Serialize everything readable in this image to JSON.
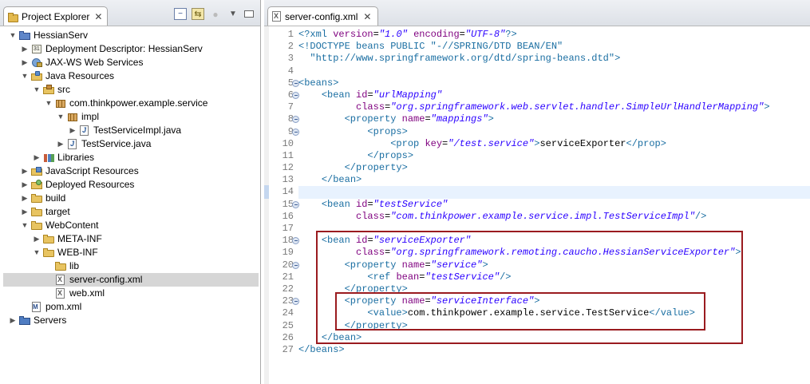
{
  "explorer": {
    "title": "Project Explorer",
    "close": "✕",
    "tools": [
      "collapse-all",
      "link-with-editor",
      "view-menu",
      "minimize"
    ],
    "tree": [
      {
        "label": "HessianServ",
        "icon": "project",
        "depth": 0,
        "twisty": "open"
      },
      {
        "label": "Deployment Descriptor: HessianServ",
        "icon": "descriptor",
        "depth": 1,
        "twisty": "closed"
      },
      {
        "label": "JAX-WS Web Services",
        "icon": "ws",
        "depth": 1,
        "twisty": "closed"
      },
      {
        "label": "Java Resources",
        "icon": "javares",
        "depth": 1,
        "twisty": "open"
      },
      {
        "label": "src",
        "icon": "srcfolder",
        "depth": 2,
        "twisty": "open"
      },
      {
        "label": "com.thinkpower.example.service",
        "icon": "pkg",
        "depth": 3,
        "twisty": "open"
      },
      {
        "label": "impl",
        "icon": "pkg",
        "depth": 4,
        "twisty": "open"
      },
      {
        "label": "TestServiceImpl.java",
        "icon": "javafile",
        "depth": 5,
        "twisty": "closed"
      },
      {
        "label": "TestService.java",
        "icon": "javafile",
        "depth": 4,
        "twisty": "closed"
      },
      {
        "label": "Libraries",
        "icon": "libs",
        "depth": 2,
        "twisty": "closed"
      },
      {
        "label": "JavaScript Resources",
        "icon": "js",
        "depth": 1,
        "twisty": "closed"
      },
      {
        "label": "Deployed Resources",
        "icon": "deployed",
        "depth": 1,
        "twisty": "closed"
      },
      {
        "label": "build",
        "icon": "folder",
        "depth": 1,
        "twisty": "closed"
      },
      {
        "label": "target",
        "icon": "folder",
        "depth": 1,
        "twisty": "closed"
      },
      {
        "label": "WebContent",
        "icon": "folder",
        "depth": 1,
        "twisty": "open"
      },
      {
        "label": "META-INF",
        "icon": "folder",
        "depth": 2,
        "twisty": "closed"
      },
      {
        "label": "WEB-INF",
        "icon": "folder",
        "depth": 2,
        "twisty": "open"
      },
      {
        "label": "lib",
        "icon": "folder",
        "depth": 3,
        "twisty": "none"
      },
      {
        "label": "server-config.xml",
        "icon": "xmlfile",
        "depth": 3,
        "twisty": "none",
        "selected": true
      },
      {
        "label": "web.xml",
        "icon": "xmlfile",
        "depth": 3,
        "twisty": "none"
      },
      {
        "label": "pom.xml",
        "icon": "maven",
        "depth": 1,
        "twisty": "none"
      },
      {
        "label": "Servers",
        "icon": "servers",
        "depth": 0,
        "twisty": "closed"
      }
    ]
  },
  "editor": {
    "tab_label": "server-config.xml",
    "tab_close": "✕",
    "current_line": 14,
    "lines": [
      {
        "n": "1",
        "fold": false,
        "tokens": [
          [
            "tg",
            "<?xml "
          ],
          [
            "at",
            "version"
          ],
          [
            "tx",
            "="
          ],
          [
            "vl",
            "\"1.0\""
          ],
          [
            "tx",
            " "
          ],
          [
            "at",
            "encoding"
          ],
          [
            "tx",
            "="
          ],
          [
            "vl",
            "\"UTF-8\""
          ],
          [
            "tg",
            "?>"
          ]
        ]
      },
      {
        "n": "2",
        "fold": false,
        "tokens": [
          [
            "tg",
            "<!DOCTYPE beans PUBLIC \"-//SPRING/DTD BEAN/EN\""
          ]
        ]
      },
      {
        "n": "3",
        "fold": false,
        "tokens": [
          [
            "tg",
            "  \"http://www.springframework.org/dtd/spring-beans.dtd\">"
          ]
        ]
      },
      {
        "n": "4",
        "fold": false,
        "tokens": []
      },
      {
        "n": "5",
        "fold": true,
        "tokens": [
          [
            "tg",
            "<beans>"
          ]
        ]
      },
      {
        "n": "6",
        "fold": true,
        "tokens": [
          [
            "tx",
            "    "
          ],
          [
            "tg",
            "<bean "
          ],
          [
            "at",
            "id"
          ],
          [
            "tx",
            "="
          ],
          [
            "vl",
            "\"urlMapping\""
          ]
        ]
      },
      {
        "n": "7",
        "fold": false,
        "tokens": [
          [
            "tx",
            "          "
          ],
          [
            "at",
            "class"
          ],
          [
            "tx",
            "="
          ],
          [
            "vl",
            "\"org.springframework.web.servlet.handler.SimpleUrlHandlerMapping\""
          ],
          [
            "tg",
            ">"
          ]
        ]
      },
      {
        "n": "8",
        "fold": true,
        "tokens": [
          [
            "tx",
            "        "
          ],
          [
            "tg",
            "<property "
          ],
          [
            "at",
            "name"
          ],
          [
            "tx",
            "="
          ],
          [
            "vl",
            "\"mappings\""
          ],
          [
            "tg",
            ">"
          ]
        ]
      },
      {
        "n": "9",
        "fold": true,
        "tokens": [
          [
            "tx",
            "            "
          ],
          [
            "tg",
            "<props>"
          ]
        ]
      },
      {
        "n": "10",
        "fold": false,
        "tokens": [
          [
            "tx",
            "                "
          ],
          [
            "tg",
            "<prop "
          ],
          [
            "at",
            "key"
          ],
          [
            "tx",
            "="
          ],
          [
            "vl",
            "\"/test.service\""
          ],
          [
            "tg",
            ">"
          ],
          [
            "tx",
            "serviceExporter"
          ],
          [
            "tg",
            "</prop>"
          ]
        ]
      },
      {
        "n": "11",
        "fold": false,
        "tokens": [
          [
            "tx",
            "            "
          ],
          [
            "tg",
            "</props>"
          ]
        ]
      },
      {
        "n": "12",
        "fold": false,
        "tokens": [
          [
            "tx",
            "        "
          ],
          [
            "tg",
            "</property>"
          ]
        ]
      },
      {
        "n": "13",
        "fold": false,
        "tokens": [
          [
            "tx",
            "    "
          ],
          [
            "tg",
            "</bean>"
          ]
        ]
      },
      {
        "n": "14",
        "fold": false,
        "tokens": []
      },
      {
        "n": "15",
        "fold": true,
        "tokens": [
          [
            "tx",
            "    "
          ],
          [
            "tg",
            "<bean "
          ],
          [
            "at",
            "id"
          ],
          [
            "tx",
            "="
          ],
          [
            "vl",
            "\"testService\""
          ]
        ]
      },
      {
        "n": "16",
        "fold": false,
        "tokens": [
          [
            "tx",
            "          "
          ],
          [
            "at",
            "class"
          ],
          [
            "tx",
            "="
          ],
          [
            "vl",
            "\"com.thinkpower.example.service.impl.TestServiceImpl\""
          ],
          [
            "tg",
            "/>"
          ]
        ]
      },
      {
        "n": "17",
        "fold": false,
        "tokens": []
      },
      {
        "n": "18",
        "fold": true,
        "tokens": [
          [
            "tx",
            "    "
          ],
          [
            "tg",
            "<bean "
          ],
          [
            "at",
            "id"
          ],
          [
            "tx",
            "="
          ],
          [
            "vl",
            "\"serviceExporter\""
          ]
        ]
      },
      {
        "n": "19",
        "fold": false,
        "tokens": [
          [
            "tx",
            "          "
          ],
          [
            "at",
            "class"
          ],
          [
            "tx",
            "="
          ],
          [
            "vl",
            "\"org.springframework.remoting.caucho.HessianServiceExporter\""
          ],
          [
            "tg",
            ">"
          ]
        ]
      },
      {
        "n": "20",
        "fold": true,
        "tokens": [
          [
            "tx",
            "        "
          ],
          [
            "tg",
            "<property "
          ],
          [
            "at",
            "name"
          ],
          [
            "tx",
            "="
          ],
          [
            "vl",
            "\"service\""
          ],
          [
            "tg",
            ">"
          ]
        ]
      },
      {
        "n": "21",
        "fold": false,
        "tokens": [
          [
            "tx",
            "            "
          ],
          [
            "tg",
            "<ref "
          ],
          [
            "at",
            "bean"
          ],
          [
            "tx",
            "="
          ],
          [
            "vl",
            "\"testService\""
          ],
          [
            "tg",
            "/>"
          ]
        ]
      },
      {
        "n": "22",
        "fold": false,
        "tokens": [
          [
            "tx",
            "        "
          ],
          [
            "tg",
            "</property>"
          ]
        ]
      },
      {
        "n": "23",
        "fold": true,
        "tokens": [
          [
            "tx",
            "        "
          ],
          [
            "tg",
            "<property "
          ],
          [
            "at",
            "name"
          ],
          [
            "tx",
            "="
          ],
          [
            "vl",
            "\"serviceInterface\""
          ],
          [
            "tg",
            ">"
          ]
        ]
      },
      {
        "n": "24",
        "fold": false,
        "tokens": [
          [
            "tx",
            "            "
          ],
          [
            "tg",
            "<value>"
          ],
          [
            "tx",
            "com.thinkpower.example.service.TestService"
          ],
          [
            "tg",
            "</value>"
          ]
        ]
      },
      {
        "n": "25",
        "fold": false,
        "tokens": [
          [
            "tx",
            "        "
          ],
          [
            "tg",
            "</property>"
          ]
        ]
      },
      {
        "n": "26",
        "fold": false,
        "tokens": [
          [
            "tx",
            "    "
          ],
          [
            "tg",
            "</bean>"
          ]
        ]
      },
      {
        "n": "27",
        "fold": false,
        "tokens": [
          [
            "tg",
            "</beans>"
          ]
        ]
      }
    ]
  }
}
